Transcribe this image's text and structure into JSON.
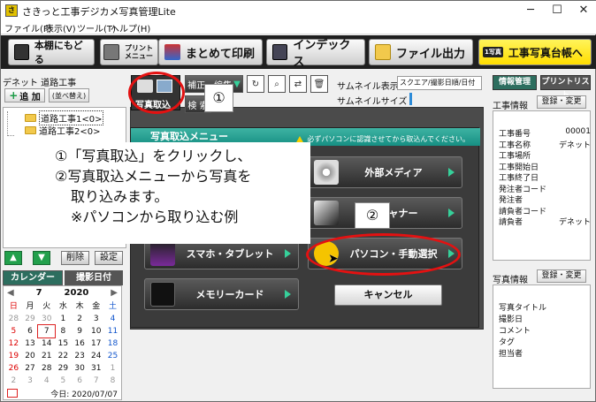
{
  "window": {
    "title": "さきっと工事デジカメ写真管理Lite",
    "app_icon": "さ",
    "minimize": "─",
    "maximize": "☐",
    "close": "✕"
  },
  "menubar": [
    "ファイル(F)",
    "表示(V)",
    "ツール(T)",
    "ヘルプ(H)"
  ],
  "toolbar": {
    "back": "本棚にもどる",
    "print_menu_line1": "プリント",
    "print_menu_line2": "メニュー",
    "batch_print": "まとめて印刷",
    "index": "インデックス",
    "file_output": "ファイル出力",
    "ledger_small": "1写真",
    "ledger": "工事写真台帳へ"
  },
  "left": {
    "title": "デネット 道路工事",
    "add": "追 加",
    "sort": "(並べ替え)",
    "tree": [
      "道路工事1<0>",
      "道路工事2<0>"
    ],
    "delete": "削除",
    "settings": "設定",
    "calendar_tab": "カレンダー",
    "shot_date_tab": "撮影日付",
    "calendar": {
      "month": "7",
      "year": "2020",
      "weekdays": [
        "日",
        "月",
        "火",
        "水",
        "木",
        "金",
        "土"
      ],
      "weeks": [
        [
          "28",
          "29",
          "30",
          "1",
          "2",
          "3",
          "4"
        ],
        [
          "5",
          "6",
          "7",
          "8",
          "9",
          "10",
          "11"
        ],
        [
          "12",
          "13",
          "14",
          "15",
          "16",
          "17",
          "18"
        ],
        [
          "19",
          "20",
          "21",
          "22",
          "23",
          "24",
          "25"
        ],
        [
          "26",
          "27",
          "28",
          "29",
          "30",
          "31",
          "1"
        ],
        [
          "2",
          "3",
          "4",
          "5",
          "6",
          "7",
          "8"
        ]
      ],
      "today_label": "今日: 2020/07/07"
    }
  },
  "center": {
    "import_label": "写真取込",
    "correct_edit": "補正・編集",
    "search": "検 索",
    "thumb_display_label": "サムネイル表示",
    "thumb_display_value": "スクエア/撮影日順/日付",
    "thumb_size_label": "サムネイルサイズ",
    "callout1": "①",
    "callout2": "②"
  },
  "dialog": {
    "title": "写真取込メニュー",
    "warning": "必ずパソコンに認識させてから取込んでください。",
    "options": {
      "external_media": "外部メディア",
      "scanner": "スキャナー",
      "smartphone": "スマホ・タブレット",
      "pc_manual": "パソコン・手動選択",
      "memory_card": "メモリーカード"
    },
    "cancel": "キャンセル"
  },
  "note": {
    "line1": "①「写真取込」をクリックし、",
    "line2": "②写真取込メニューから写真を",
    "line3": "取り込みます。",
    "line4": "※パソコンから取り込む例"
  },
  "right": {
    "tab_info": "情報管理",
    "tab_print": "プリントリスト",
    "work_info": "工事情報",
    "reg_change": "登録・変更",
    "work_rows": [
      [
        "工事番号",
        "00001"
      ],
      [
        "工事名称",
        "デネット"
      ],
      [
        "工事場所",
        ""
      ],
      [
        "工事開始日",
        ""
      ],
      [
        "工事終了日",
        ""
      ],
      [
        "発注者コード",
        ""
      ],
      [
        "発注者",
        ""
      ],
      [
        "請負者コード",
        ""
      ],
      [
        "請負者",
        "デネット"
      ]
    ],
    "photo_info": "写真情報",
    "photo_rows": [
      "写真タイトル",
      "撮影日",
      "コメント",
      "タグ",
      "担当者"
    ]
  },
  "colors": {
    "accent_red": "#e41111",
    "dialog_teal": "#168f83",
    "toolbar_yellow": "#ffdd00"
  }
}
